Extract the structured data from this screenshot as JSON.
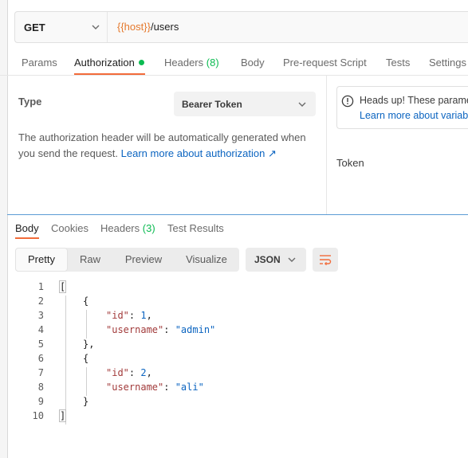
{
  "request": {
    "method": "GET",
    "url_var": "{{host}}",
    "url_path": "/users"
  },
  "request_tabs": {
    "params": "Params",
    "authorization": "Authorization",
    "headers": "Headers",
    "headers_count": "(8)",
    "body": "Body",
    "prerequest": "Pre-request Script",
    "tests": "Tests",
    "settings": "Settings"
  },
  "auth": {
    "type_label": "Type",
    "type_value": "Bearer Token",
    "description": "The authorization header will be automatically generated when you send the request.",
    "learn_more": "Learn more about authorization ↗",
    "headsup_title": "Heads up! These parame",
    "headsup_link": "Learn more about variab",
    "token_label": "Token"
  },
  "response_tabs": {
    "body": "Body",
    "cookies": "Cookies",
    "headers": "Headers",
    "headers_count": "(3)",
    "test_results": "Test Results"
  },
  "view_modes": {
    "pretty": "Pretty",
    "raw": "Raw",
    "preview": "Preview",
    "visualize": "Visualize"
  },
  "format": "JSON",
  "code_lines": [
    {
      "n": "1",
      "text": "["
    },
    {
      "n": "2",
      "text": "{"
    },
    {
      "n": "3",
      "key": "\"id\"",
      "sep": ": ",
      "num": "1",
      "tail": ","
    },
    {
      "n": "4",
      "key": "\"username\"",
      "sep": ": ",
      "str": "\"admin\""
    },
    {
      "n": "5",
      "text": "},"
    },
    {
      "n": "6",
      "text": "{"
    },
    {
      "n": "7",
      "key": "\"id\"",
      "sep": ": ",
      "num": "2",
      "tail": ","
    },
    {
      "n": "8",
      "key": "\"username\"",
      "sep": ": ",
      "str": "\"ali\""
    },
    {
      "n": "9",
      "text": "}"
    },
    {
      "n": "10",
      "text": "]"
    }
  ],
  "colors": {
    "accent": "#f26b3a",
    "status_green": "#0cbb52",
    "link_blue": "#0b64c0",
    "var_orange": "#e5792d",
    "json_key": "#a23b3b"
  },
  "icons": {
    "method_chevron": "chevron-down-icon",
    "info": "info-icon",
    "wrap": "wrap-lines-icon"
  }
}
